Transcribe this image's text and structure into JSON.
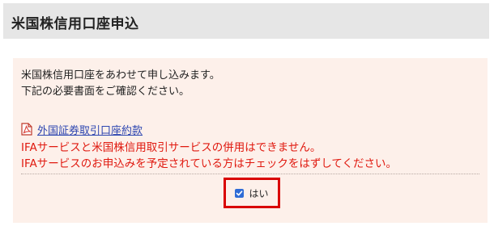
{
  "header": {
    "title": "米国株信用口座申込"
  },
  "intro": {
    "line1": "米国株信用口座をあわせて申し込みます。",
    "line2": "下記の必要書面をご確認ください。"
  },
  "document": {
    "icon": "pdf-icon",
    "link_label": "外国証券取引口座約款"
  },
  "warnings": {
    "line1": "IFAサービスと米国株信用取引サービスの併用はできません。",
    "line2": "IFAサービスのお申込みを予定されている方はチェックをはずしてください。"
  },
  "confirm": {
    "label": "はい",
    "checked": true
  },
  "colors": {
    "warning_text": "#e0190f",
    "link": "#2c45b0",
    "panel_background": "#fdf0ea",
    "highlight_border": "#d90000",
    "checkbox": "#2f6cd6"
  }
}
